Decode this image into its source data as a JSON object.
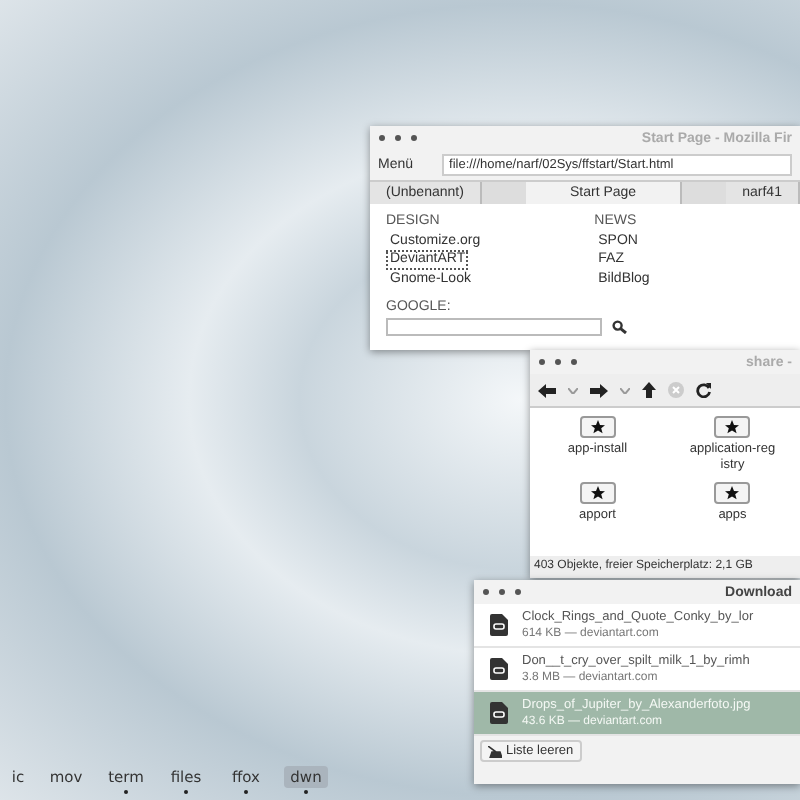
{
  "browser": {
    "title": "Start Page - Mozilla Fir",
    "menu": "Menü",
    "url": "file:///home/narf/02Sys/ffstart/Start.html",
    "tabs": [
      {
        "label": "(Unbenannt)",
        "selected": false
      },
      {
        "label": "Start Page",
        "selected": true
      },
      {
        "label": "narf41",
        "selected": false
      }
    ],
    "sections": [
      {
        "heading": "DESIGN",
        "links": [
          {
            "label": "Customize.org",
            "focused": false
          },
          {
            "label": "DeviantART",
            "focused": true
          },
          {
            "label": "Gnome-Look",
            "focused": false
          }
        ]
      },
      {
        "heading": "NEWS",
        "links": [
          {
            "label": "SPON",
            "focused": false
          },
          {
            "label": "FAZ",
            "focused": false
          },
          {
            "label": "BildBlog",
            "focused": false
          }
        ]
      }
    ],
    "search_label": "GOOGLE:"
  },
  "files": {
    "title": "share -",
    "items": [
      "app-install",
      "application-registry",
      "apport",
      "apps"
    ],
    "status": "403 Objekte, freier Speicherplatz: 2,1 GB"
  },
  "downloads": {
    "title": "Download",
    "items": [
      {
        "name": "Clock_Rings_and_Quote_Conky_by_lor",
        "meta": "614 KB — deviantart.com",
        "selected": false
      },
      {
        "name": "Don__t_cry_over_spilt_milk_1_by_rimh",
        "meta": "3.8 MB — deviantart.com",
        "selected": false
      },
      {
        "name": "Drops_of_Jupiter_by_Alexanderfoto.jpg",
        "meta": "43.6 KB — deviantart.com",
        "selected": true
      }
    ],
    "clear_button": "Liste leeren"
  },
  "dock": [
    {
      "label": "ic",
      "selected": false,
      "running": false
    },
    {
      "label": "mov",
      "selected": false,
      "running": false
    },
    {
      "label": "term",
      "selected": false,
      "running": true
    },
    {
      "label": "files",
      "selected": false,
      "running": true
    },
    {
      "label": "ffox",
      "selected": false,
      "running": true
    },
    {
      "label": "dwn",
      "selected": true,
      "running": true
    }
  ]
}
